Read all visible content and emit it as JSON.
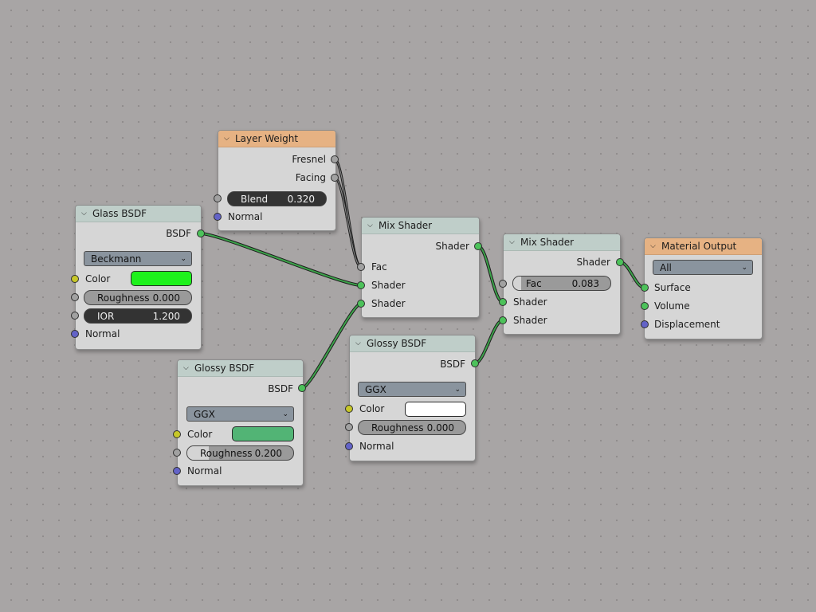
{
  "nodes": {
    "layer_weight": {
      "title": "Layer Weight",
      "outputs": [
        "Fresnel",
        "Facing"
      ],
      "blend_label": "Blend",
      "blend_value": "0.320",
      "normal_label": "Normal"
    },
    "glass_bsdf": {
      "title": "Glass BSDF",
      "output": "BSDF",
      "distribution": "Beckmann",
      "color_label": "Color",
      "color": "#1ef21c",
      "roughness_label": "Roughness",
      "roughness_value": "0.000",
      "ior_label": "IOR",
      "ior_value": "1.200",
      "normal_label": "Normal"
    },
    "mix_shader_1": {
      "title": "Mix Shader",
      "output": "Shader",
      "fac_label": "Fac",
      "shader_a": "Shader",
      "shader_b": "Shader"
    },
    "glossy_bsdf_1": {
      "title": "Glossy BSDF",
      "output": "BSDF",
      "distribution": "GGX",
      "color_label": "Color",
      "color": "#52b475",
      "roughness_label": "Roughness",
      "roughness_value": "0.200",
      "roughness_fraction": 0.2,
      "normal_label": "Normal"
    },
    "glossy_bsdf_2": {
      "title": "Glossy BSDF",
      "output": "BSDF",
      "distribution": "GGX",
      "color_label": "Color",
      "color": "#ffffff",
      "roughness_label": "Roughness",
      "roughness_value": "0.000",
      "normal_label": "Normal"
    },
    "mix_shader_2": {
      "title": "Mix Shader",
      "output": "Shader",
      "fac_label": "Fac",
      "fac_value": "0.083",
      "fac_fraction": 0.083,
      "shader_a": "Shader",
      "shader_b": "Shader"
    },
    "material_output": {
      "title": "Material Output",
      "target": "All",
      "inputs": [
        "Surface",
        "Volume",
        "Displacement"
      ]
    }
  },
  "icons": {
    "collapse": "chevron-down-icon",
    "dropdown": "chevron-down-icon"
  },
  "colors": {
    "shader_socket": "#4cc25a",
    "float_socket": "#a1a1a1",
    "color_socket": "#c7c729",
    "vector_socket": "#6363c7",
    "shader_link": "#3ca24a",
    "float_link": "#3a3a3a"
  }
}
